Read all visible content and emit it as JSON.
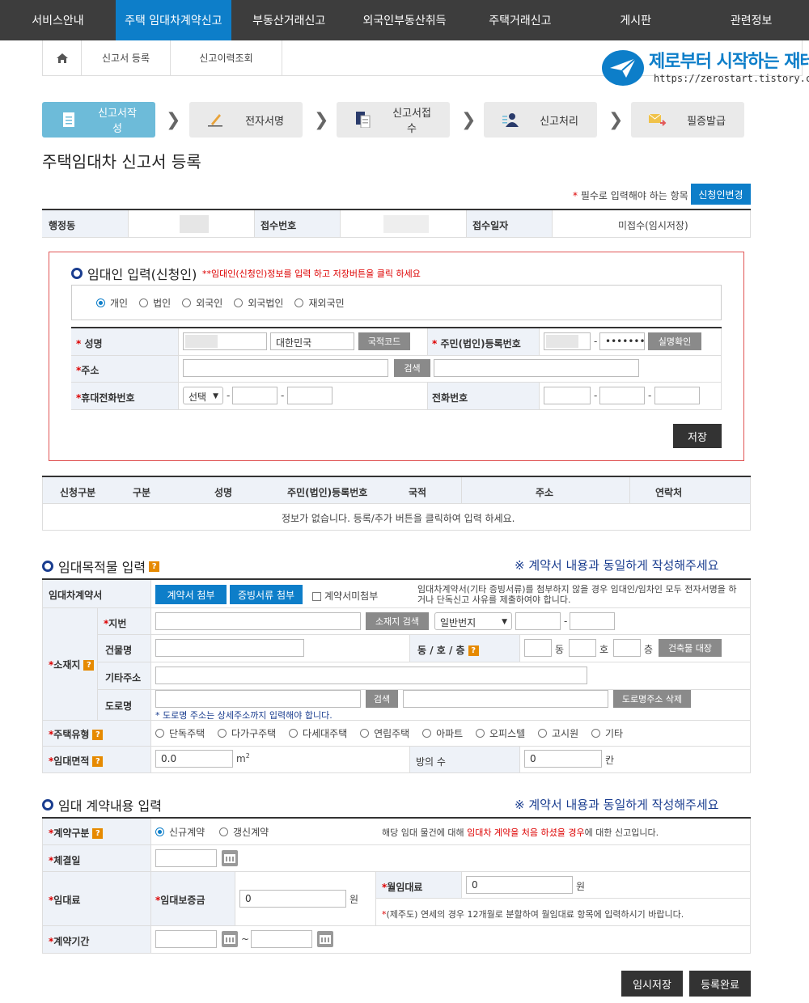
{
  "topnav": [
    "서비스안내",
    "주택 임대차계약신고",
    "부동산거래신고",
    "외국인부동산취득",
    "주택거래신고",
    "게시판",
    "관련정보"
  ],
  "breadcrumb": {
    "home_icon": "home-icon",
    "items": [
      "신고서 등록",
      "신고이력조회"
    ]
  },
  "logo": {
    "brand": "제로부터 시작하는 재테크",
    "url": "https://zerostart.tistory.com/"
  },
  "steps": [
    "신고서작성",
    "전자서명",
    "신고서접수",
    "신고처리",
    "필증발급"
  ],
  "page_title": "주택임대차 신고서 등록",
  "required_note": "필수로 입력해야 하는 항목",
  "change_applicant_button": "신청인변경",
  "info_row": {
    "h1": "행정동",
    "h2": "접수번호",
    "h3": "접수일자",
    "receipt_date_value": "미접수(임시저장)"
  },
  "applicant": {
    "title": "임대인 입력(신청인)",
    "note": "**임대인(신청인)정보를 입력 하고 저장버튼을 클릭 하세요",
    "types": [
      "개인",
      "법인",
      "외국인",
      "외국법인",
      "재외국민"
    ],
    "name_label": "성명",
    "nationality_value": "대한민국",
    "country_code_button": "국적코드",
    "rrn_label": "주민(법인)등록번호",
    "rrn_masked": "•••••••",
    "verify_button": "실명확인",
    "address_label": "주소",
    "search_button": "검색",
    "mobile_label": "휴대전화번호",
    "mobile_select": "선택",
    "phone_label": "전화번호",
    "save_button": "저장"
  },
  "applicant_table": {
    "headers": [
      "신청구분",
      "구분",
      "성명",
      "주민(법인)등록번호",
      "국적",
      "주소",
      "연락처"
    ],
    "empty_message": "정보가 없습니다.  등록/추가 버튼을 클릭하여 입력 하세요."
  },
  "property": {
    "title": "임대목적물 입력",
    "notice": "※ 계약서 내용과 동일하게 작성해주세요",
    "contract_label": "임대차계약서",
    "attach_contract_button": "계약서 첨부",
    "attach_evidence_button": "증빙서류 첨부",
    "no_contract_checkbox": "계약서미첨부",
    "attach_help": "임대차계약서(기타 증빙서류)를 첨부하지 않을 경우 임대인/임차인 모두 전자서명을 하거나 단독신고 사유를 제출하여야 합니다.",
    "location_label": "소재지",
    "lot_label": "지번",
    "location_search_button": "소재지 검색",
    "lot_select": "일반번지",
    "building_label": "건물명",
    "dong_ho_label": "동 / 호 / 층",
    "dong": "동",
    "ho": "호",
    "floor": "층",
    "registry_button": "건축물 대장",
    "other_address_label": "기타주소",
    "road_label": "도로명",
    "road_search_button": "검색",
    "road_delete_button": "도로명주소 삭제",
    "road_note": "* 도로명 주소는 상세주소까지 입력해야 합니다.",
    "housing_type_label": "주택유형",
    "housing_types": [
      "단독주택",
      "다가구주택",
      "다세대주택",
      "연립주택",
      "아파트",
      "오피스텔",
      "고시원",
      "기타"
    ],
    "area_label": "임대면적",
    "area_value": "0.0",
    "area_unit": "m",
    "area_unit_sup": "2",
    "rooms_label": "방의 수",
    "rooms_value": "0",
    "rooms_unit": "칸"
  },
  "contract": {
    "title": "임대 계약내용 입력",
    "notice": "※ 계약서 내용과 동일하게 작성해주세요",
    "type_label": "계약구분",
    "types": [
      "신규계약",
      "갱신계약"
    ],
    "type_help_pre": "해당 임대 물건에 대해 ",
    "type_help_red": "임대차 계약을 처음 하셨을 경우",
    "type_help_post": "에 대한 신고입니다.",
    "signed_label": "체결일",
    "rent_label": "임대료",
    "deposit_label": "임대보증금",
    "deposit_value": "0",
    "won": "원",
    "monthly_label": "월임대료",
    "monthly_value": "0",
    "monthly_note": "(제주도) 연세의 경우 12개월로 분할하여 월임대료 항목에 입력하시기 바랍니다.",
    "period_label": "계약기간",
    "tilde": "~"
  },
  "footer": {
    "temp_save_button": "임시저장",
    "complete_button": "등록완료"
  }
}
